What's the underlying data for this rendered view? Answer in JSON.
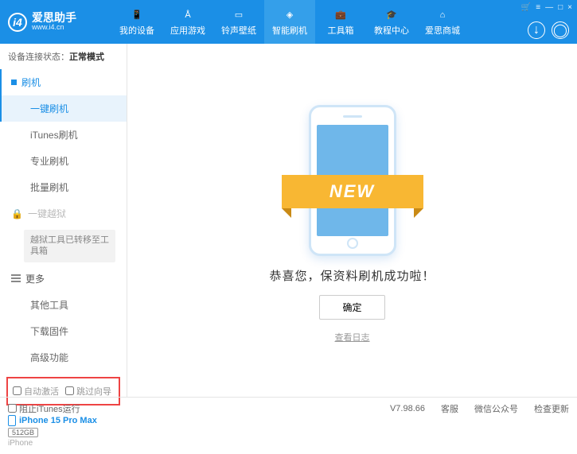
{
  "header": {
    "logo_title": "爱思助手",
    "logo_sub": "www.i4.cn",
    "tabs": [
      "我的设备",
      "应用游戏",
      "铃声壁纸",
      "智能刷机",
      "工具箱",
      "教程中心",
      "爱思商城"
    ],
    "win_controls": {
      "cart": "🛒",
      "menu_dots": "≡",
      "min": "—",
      "max": "□",
      "close": "×"
    }
  },
  "sidebar": {
    "status_label": "设备连接状态：",
    "status_value": "正常模式",
    "sections": {
      "flash": {
        "title": "刷机",
        "items": [
          "一键刷机",
          "iTunes刷机",
          "专业刷机",
          "批量刷机"
        ]
      },
      "jailbreak": {
        "title": "一键越狱",
        "box": "越狱工具已转移至工具箱"
      },
      "more": {
        "title": "更多",
        "items": [
          "其他工具",
          "下载固件",
          "高级功能"
        ]
      }
    },
    "checks": {
      "auto_activate": "自动激活",
      "skip_setup": "跳过向导"
    },
    "device": {
      "name": "iPhone 15 Pro Max",
      "storage": "512GB",
      "type": "iPhone"
    }
  },
  "main": {
    "ribbon": "NEW",
    "success": "恭喜您，保资料刷机成功啦！",
    "ok": "确定",
    "log": "查看日志"
  },
  "footer": {
    "block_itunes": "阻止iTunes运行",
    "version": "V7.98.66",
    "links": [
      "客服",
      "微信公众号",
      "检查更新"
    ]
  }
}
